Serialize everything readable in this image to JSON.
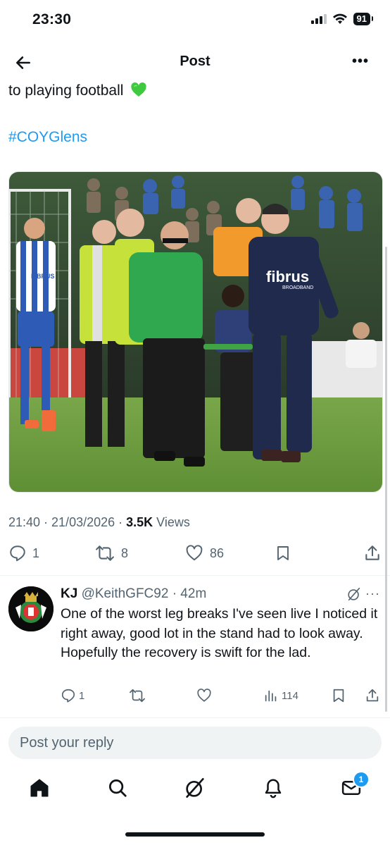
{
  "status_bar": {
    "time": "23:30",
    "battery": "91"
  },
  "header": {
    "title": "Post"
  },
  "tweet": {
    "text_line": "to playing football",
    "hashtag": "#COYGlens",
    "media": {
      "shirt_sponsor": "fibrus",
      "shirt_sponsor_sub": "BROADBAND",
      "player_shirt_sponsor": "FIBRUS"
    },
    "timestamp": "21:40 · 21/03/2026 · ",
    "views_count": "3.5K",
    "views_label": " Views",
    "actions": {
      "replies": "1",
      "reposts": "8",
      "likes": "86"
    }
  },
  "reply": {
    "name": "KJ",
    "handle": "@KeithGFC92",
    "time": " · 42m",
    "text": "One of the worst leg breaks I've seen live I noticed it right away, good lot in the stand had to look away. Hopefully the recovery is swift for the lad.",
    "actions": {
      "replies": "1",
      "views": "114"
    }
  },
  "composer": {
    "placeholder": "Post your reply"
  },
  "nav": {
    "messages_badge": "1"
  },
  "colors": {
    "accent": "#1d9bf0",
    "heart_emoji": "#3ec93e",
    "text": "#0f1419",
    "muted": "#536471"
  }
}
